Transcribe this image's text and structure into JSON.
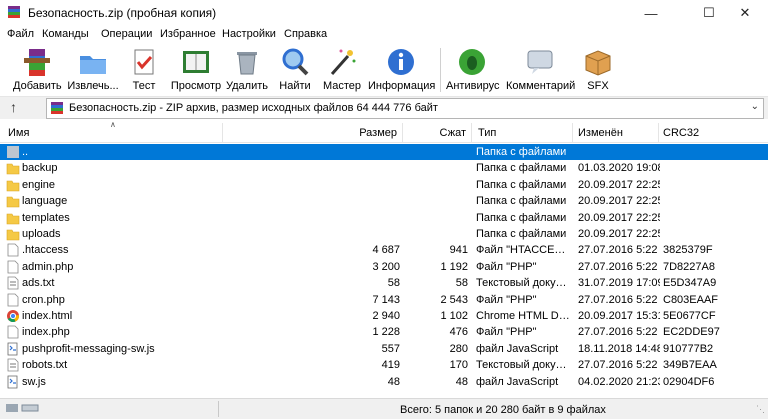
{
  "window": {
    "title": "Безопасность.zip (пробная копия)"
  },
  "menu": [
    "Файл",
    "Команды",
    "Операции",
    "Избранное",
    "Настройки",
    "Справка"
  ],
  "toolbar": [
    {
      "label": "Добавить",
      "icon": "add-archive-icon"
    },
    {
      "label": "Извлечь...",
      "icon": "extract-icon"
    },
    {
      "label": "Тест",
      "icon": "test-icon"
    },
    {
      "label": "Просмотр",
      "icon": "view-icon"
    },
    {
      "label": "Удалить",
      "icon": "delete-icon"
    },
    {
      "label": "Найти",
      "icon": "find-icon"
    },
    {
      "label": "Мастер",
      "icon": "wizard-icon"
    },
    {
      "label": "Информация",
      "icon": "info-icon"
    },
    {
      "label": "Антивирус",
      "icon": "antivirus-icon"
    },
    {
      "label": "Комментарий",
      "icon": "comment-icon"
    },
    {
      "label": "SFX",
      "icon": "sfx-icon"
    }
  ],
  "address": {
    "text": "Безопасность.zip - ZIP архив, размер исходных файлов 64 444 776 байт"
  },
  "columns": {
    "name": "Имя",
    "size": "Размер",
    "packed": "Сжат",
    "type": "Тип",
    "modified": "Изменён",
    "crc": "CRC32"
  },
  "files": [
    {
      "name": "..",
      "size": "",
      "packed": "",
      "type": "Папка с файлами",
      "modified": "",
      "crc": "",
      "kind": "up"
    },
    {
      "name": "backup",
      "size": "",
      "packed": "",
      "type": "Папка с файлами",
      "modified": "01.03.2020 19:08",
      "crc": "",
      "kind": "folder"
    },
    {
      "name": "engine",
      "size": "",
      "packed": "",
      "type": "Папка с файлами",
      "modified": "20.09.2017 22:25",
      "crc": "",
      "kind": "folder"
    },
    {
      "name": "language",
      "size": "",
      "packed": "",
      "type": "Папка с файлами",
      "modified": "20.09.2017 22:25",
      "crc": "",
      "kind": "folder"
    },
    {
      "name": "templates",
      "size": "",
      "packed": "",
      "type": "Папка с файлами",
      "modified": "20.09.2017 22:25",
      "crc": "",
      "kind": "folder"
    },
    {
      "name": "uploads",
      "size": "",
      "packed": "",
      "type": "Папка с файлами",
      "modified": "20.09.2017 22:25",
      "crc": "",
      "kind": "folder"
    },
    {
      "name": ".htaccess",
      "size": "4 687",
      "packed": "941",
      "type": "Файл \"HTACCESS\"",
      "modified": "27.07.2016 5:22",
      "crc": "3825379F",
      "kind": "file"
    },
    {
      "name": "admin.php",
      "size": "3 200",
      "packed": "1 192",
      "type": "Файл \"PHP\"",
      "modified": "27.07.2016 5:22",
      "crc": "7D8227A8",
      "kind": "file"
    },
    {
      "name": "ads.txt",
      "size": "58",
      "packed": "58",
      "type": "Текстовый докум...",
      "modified": "31.07.2019 17:09",
      "crc": "E5D347A9",
      "kind": "text"
    },
    {
      "name": "cron.php",
      "size": "7 143",
      "packed": "2 543",
      "type": "Файл \"PHP\"",
      "modified": "27.07.2016 5:22",
      "crc": "C803EAAF",
      "kind": "file"
    },
    {
      "name": "index.html",
      "size": "2 940",
      "packed": "1 102",
      "type": "Chrome HTML Do...",
      "modified": "20.09.2017 15:31",
      "crc": "5E0677CF",
      "kind": "chrome"
    },
    {
      "name": "index.php",
      "size": "1 228",
      "packed": "476",
      "type": "Файл \"PHP\"",
      "modified": "27.07.2016 5:22",
      "crc": "EC2DDE97",
      "kind": "file"
    },
    {
      "name": "pushprofit-messaging-sw.js",
      "size": "557",
      "packed": "280",
      "type": "файл JavaScript",
      "modified": "18.11.2018 14:48",
      "crc": "910777B2",
      "kind": "script"
    },
    {
      "name": "robots.txt",
      "size": "419",
      "packed": "170",
      "type": "Текстовый докум...",
      "modified": "27.07.2016 5:22",
      "crc": "349B7EAA",
      "kind": "text"
    },
    {
      "name": "sw.js",
      "size": "48",
      "packed": "48",
      "type": "файл JavaScript",
      "modified": "04.02.2020 21:23",
      "crc": "02904DF6",
      "kind": "script"
    }
  ],
  "status": {
    "text": "Всего: 5 папок и 20 280 байт в 9 файлах"
  },
  "colors": {
    "selection": "#0078d7",
    "folder": "#f5c945"
  }
}
